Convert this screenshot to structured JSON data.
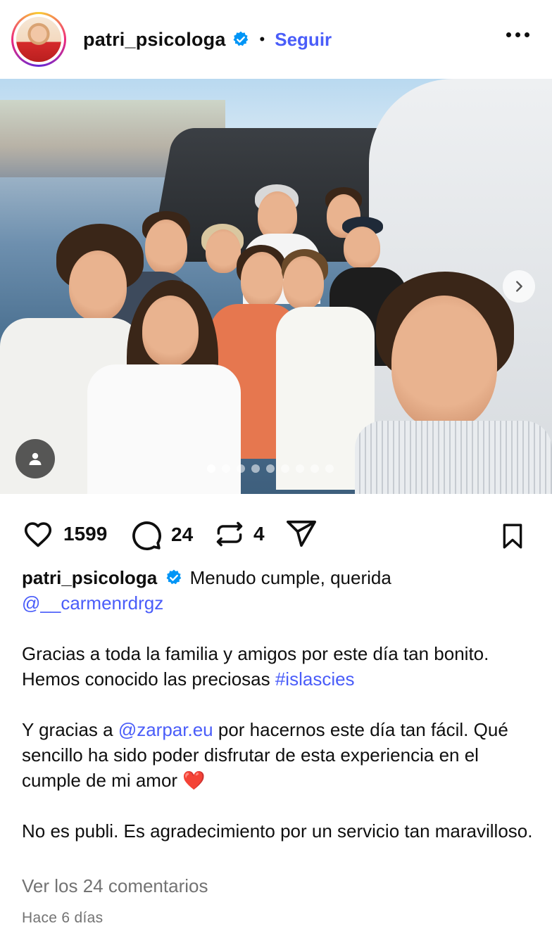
{
  "header": {
    "username": "patri_psicologa",
    "separator": "•",
    "follow_label": "Seguir"
  },
  "photo": {
    "carousel_total": 9,
    "carousel_active_index": 0
  },
  "actions": {
    "likes": "1599",
    "comments": "24",
    "reposts": "4"
  },
  "caption": {
    "username": "patri_psicologa",
    "line1_text": "Menudo cumple, querida",
    "mention1": "@__carmenrdrgz",
    "p2_text": "Gracias a toda la familia y amigos por este día tan bonito. Hemos conocido las preciosas ",
    "hashtag": "#islascies",
    "p3_pre": "Y gracias a ",
    "mention2": "@zarpar.eu",
    "p3_post": " por hacernos este día tan fácil. Qué sencillo ha sido poder disfrutar de esta experiencia en el cumple de mi amor ",
    "heart_emoji": "❤️",
    "p4_text": "No es publi. Es agradecimiento por un servicio tan maravilloso."
  },
  "footer": {
    "view_comments": "Ver los 24 comentarios",
    "timestamp": "Hace 6 días"
  },
  "colors": {
    "link": "#4a5df9",
    "verified": "#0095f6",
    "muted": "#737373",
    "text": "#0f0f0f"
  }
}
